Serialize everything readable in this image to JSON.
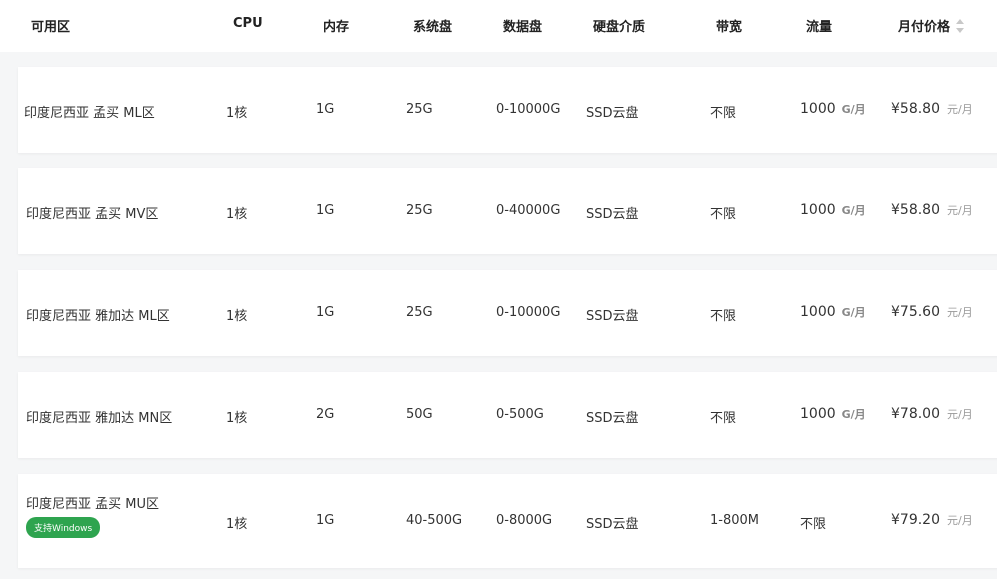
{
  "headers": {
    "zone": "可用区",
    "cpu": "CPU",
    "memory": "内存",
    "system_disk": "系统盘",
    "data_disk": "数据盘",
    "disk_type": "硬盘介质",
    "bandwidth": "带宽",
    "traffic": "流量",
    "price": "月付价格"
  },
  "rows": [
    {
      "zone": "印度尼西亚 孟买 ML区",
      "cpu": "1核",
      "memory": "1G",
      "system_disk": "25G",
      "data_disk": "0-10000G",
      "disk_type": "SSD云盘",
      "bandwidth": "不限",
      "traffic": "1000",
      "traffic_unit": "G/月",
      "price": "¥58.80",
      "price_unit": "元/月"
    },
    {
      "zone": "印度尼西亚 孟买 MV区",
      "cpu": "1核",
      "memory": "1G",
      "system_disk": "25G",
      "data_disk": "0-40000G",
      "disk_type": "SSD云盘",
      "bandwidth": "不限",
      "traffic": "1000",
      "traffic_unit": "G/月",
      "price": "¥58.80",
      "price_unit": "元/月"
    },
    {
      "zone": "印度尼西亚 雅加达 ML区",
      "cpu": "1核",
      "memory": "1G",
      "system_disk": "25G",
      "data_disk": "0-10000G",
      "disk_type": "SSD云盘",
      "bandwidth": "不限",
      "traffic": "1000",
      "traffic_unit": "G/月",
      "price": "¥75.60",
      "price_unit": "元/月"
    },
    {
      "zone": "印度尼西亚 雅加达 MN区",
      "cpu": "1核",
      "memory": "2G",
      "system_disk": "50G",
      "data_disk": "0-500G",
      "disk_type": "SSD云盘",
      "bandwidth": "不限",
      "traffic": "1000",
      "traffic_unit": "G/月",
      "price": "¥78.00",
      "price_unit": "元/月"
    },
    {
      "zone": "印度尼西亚 孟买 MU区",
      "badge": "支持Windows",
      "cpu": "1核",
      "memory": "1G",
      "system_disk": "40-500G",
      "data_disk": "0-8000G",
      "disk_type": "SSD云盘",
      "bandwidth": "1-800M",
      "traffic": "不限",
      "price": "¥79.20",
      "price_unit": "元/月"
    }
  ],
  "colors": {
    "badge": "#2ea44f",
    "row_bg": "#ffffff",
    "page_bg": "#f5f6f7"
  },
  "icons": {
    "price_sort": "sort-icon"
  }
}
